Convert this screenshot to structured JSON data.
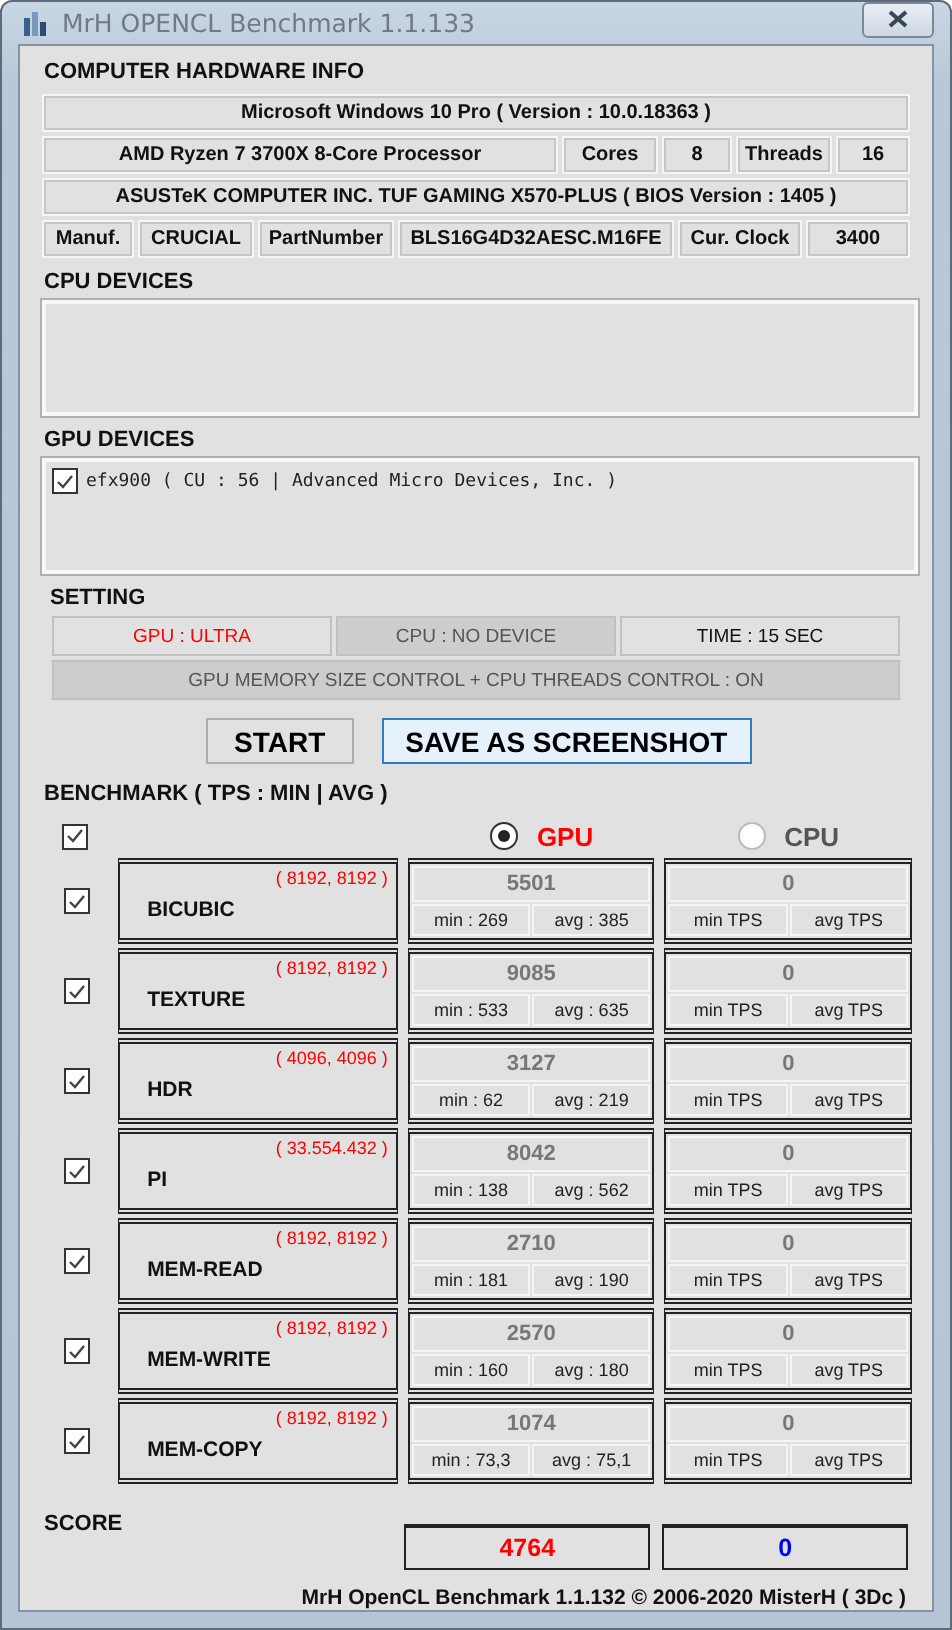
{
  "window": {
    "title": "MrH OPENCL Benchmark 1.1.133"
  },
  "hardware_info": {
    "title": "COMPUTER HARDWARE INFO",
    "os": "Microsoft Windows 10 Pro ( Version : 10.0.18363 )",
    "processor": {
      "name": "AMD Ryzen 7 3700X 8-Core Processor",
      "cores_label": "Cores",
      "cores": "8",
      "threads_label": "Threads",
      "threads": "16"
    },
    "motherboard": "ASUSTeK COMPUTER INC. TUF GAMING X570-PLUS ( BIOS Version : 1405 )",
    "memory": {
      "manuf_label": "Manuf.",
      "manuf": "CRUCIAL",
      "part_label": "PartNumber",
      "part": "BLS16G4D32AESC.M16FE",
      "clock_label": "Cur. Clock",
      "clock": "3400"
    }
  },
  "cpu_devices": {
    "title": "CPU DEVICES"
  },
  "gpu_devices": {
    "title": "GPU DEVICES",
    "items": [
      {
        "label": "efx900 ( CU : 56 | Advanced Micro Devices, Inc. )",
        "checked": true
      }
    ]
  },
  "setting": {
    "title": "SETTING",
    "items": [
      {
        "text": "GPU : ULTRA",
        "kind": "active"
      },
      {
        "text": "CPU : NO DEVICE",
        "kind": "disabled"
      },
      {
        "text": "TIME : 15 SEC",
        "kind": "normal"
      }
    ],
    "note": {
      "text": "GPU MEMORY SIZE CONTROL + CPU THREADS CONTROL : ON",
      "kind": "disabled"
    }
  },
  "buttons": [
    {
      "label": "START",
      "kind": "plain"
    },
    {
      "label": "SAVE AS SCREENSHOT",
      "kind": "primary"
    }
  ],
  "benchmark": {
    "title": "BENCHMARK ( TPS : MIN | AVG )",
    "all_checked": true,
    "devices": [
      {
        "label": "GPU",
        "selected": true
      },
      {
        "label": "CPU",
        "selected": false
      }
    ],
    "tests": [
      {
        "name": "BICUBIC",
        "size": "( 8192, 8192 )",
        "checked": true,
        "gpu": {
          "score": "5501",
          "min": "min : 269",
          "avg": "avg : 385"
        },
        "cpu": {
          "score": "0",
          "min": "min TPS",
          "avg": "avg TPS"
        }
      },
      {
        "name": "TEXTURE",
        "size": "( 8192, 8192 )",
        "checked": true,
        "gpu": {
          "score": "9085",
          "min": "min : 533",
          "avg": "avg : 635"
        },
        "cpu": {
          "score": "0",
          "min": "min TPS",
          "avg": "avg TPS"
        }
      },
      {
        "name": "HDR",
        "size": "( 4096, 4096 )",
        "checked": true,
        "gpu": {
          "score": "3127",
          "min": "min : 62",
          "avg": "avg : 219"
        },
        "cpu": {
          "score": "0",
          "min": "min TPS",
          "avg": "avg TPS"
        }
      },
      {
        "name": "PI",
        "size": "( 33.554.432 )",
        "checked": true,
        "gpu": {
          "score": "8042",
          "min": "min : 138",
          "avg": "avg : 562"
        },
        "cpu": {
          "score": "0",
          "min": "min TPS",
          "avg": "avg TPS"
        }
      },
      {
        "name": "MEM-READ",
        "size": "( 8192, 8192 )",
        "checked": true,
        "gpu": {
          "score": "2710",
          "min": "min : 181",
          "avg": "avg : 190"
        },
        "cpu": {
          "score": "0",
          "min": "min TPS",
          "avg": "avg TPS"
        }
      },
      {
        "name": "MEM-WRITE",
        "size": "( 8192, 8192 )",
        "checked": true,
        "gpu": {
          "score": "2570",
          "min": "min : 160",
          "avg": "avg : 180"
        },
        "cpu": {
          "score": "0",
          "min": "min TPS",
          "avg": "avg TPS"
        }
      },
      {
        "name": "MEM-COPY",
        "size": "( 8192, 8192 )",
        "checked": true,
        "gpu": {
          "score": "1074",
          "min": "min : 73,3",
          "avg": "avg : 75,1"
        },
        "cpu": {
          "score": "0",
          "min": "min TPS",
          "avg": "avg TPS"
        }
      }
    ]
  },
  "score": {
    "title": "SCORE",
    "gpu": "4764",
    "cpu": "0"
  },
  "footer": "MrH OpenCL Benchmark 1.1.132  ©  2006-2020 MisterH ( 3Dc )"
}
